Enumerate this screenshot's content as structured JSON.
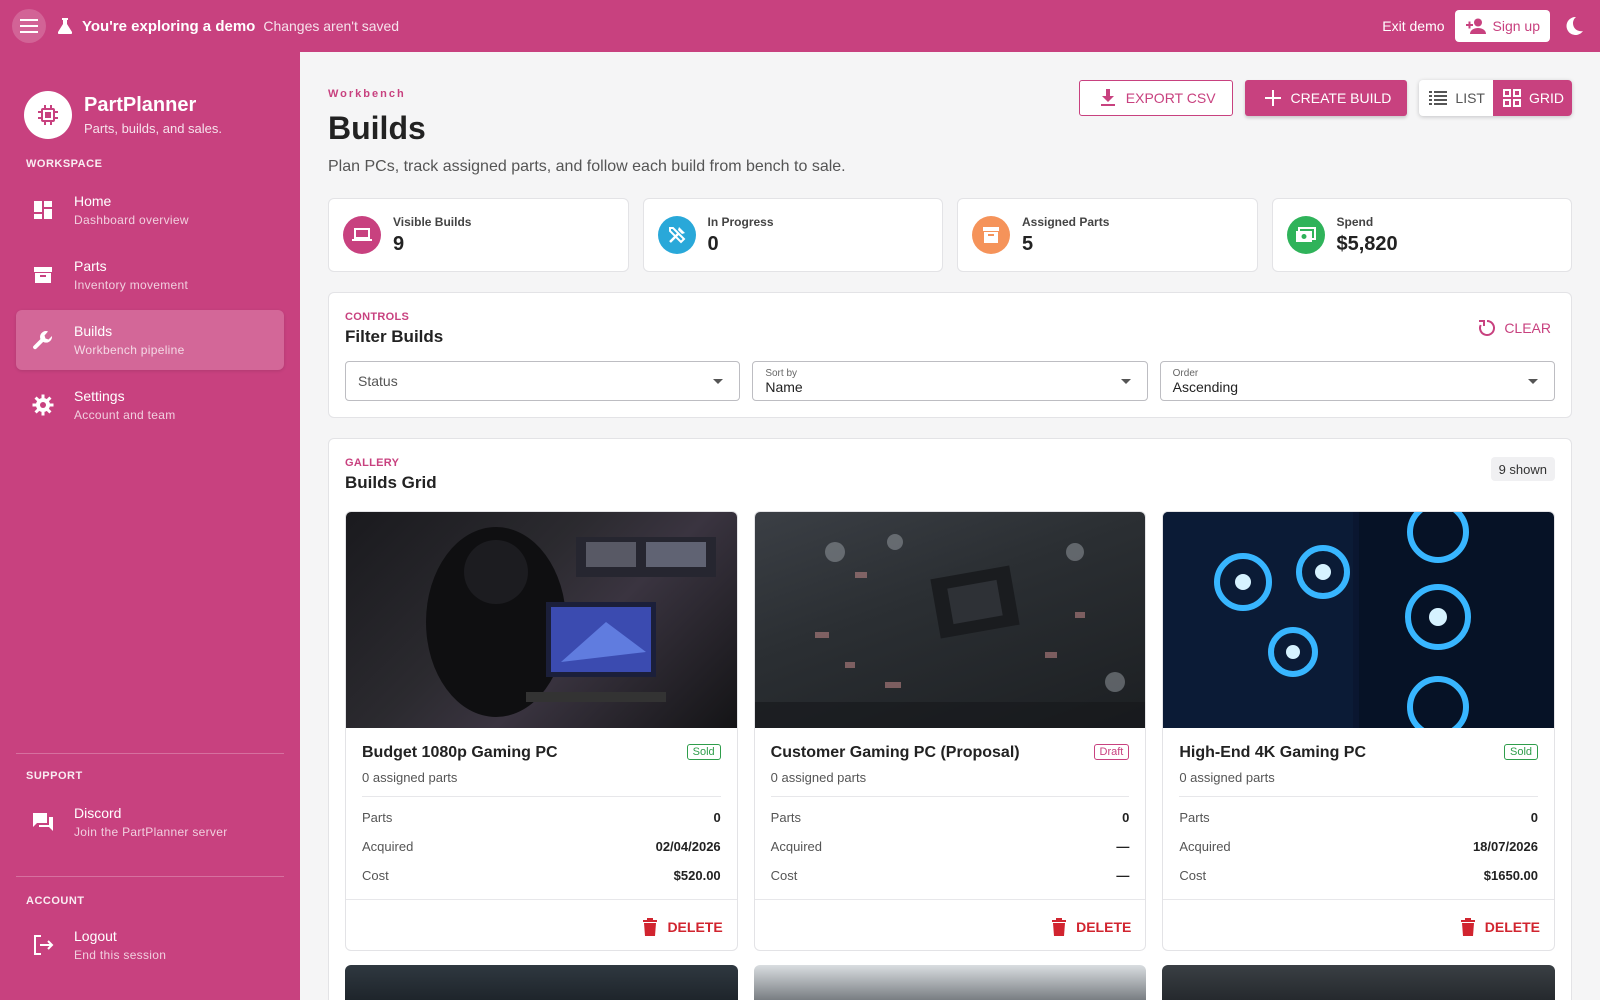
{
  "topbar": {
    "demo_title": "You're exploring a demo",
    "demo_subtitle": "Changes aren't saved",
    "exit_label": "Exit demo",
    "signup_label": "Sign up"
  },
  "brand": {
    "name": "PartPlanner",
    "tagline": "Parts, builds, and sales."
  },
  "sidebar": {
    "sections": {
      "workspace": "WORKSPACE",
      "support": "SUPPORT",
      "account": "ACCOUNT"
    },
    "items": [
      {
        "label": "Home",
        "desc": "Dashboard overview",
        "icon": "dashboard-icon"
      },
      {
        "label": "Parts",
        "desc": "Inventory movement",
        "icon": "archive-icon"
      },
      {
        "label": "Builds",
        "desc": "Workbench pipeline",
        "icon": "wrench-icon",
        "active": true
      },
      {
        "label": "Settings",
        "desc": "Account and team",
        "icon": "gear-icon"
      }
    ],
    "support_items": [
      {
        "label": "Discord",
        "desc": "Join the PartPlanner server",
        "icon": "chat-icon"
      }
    ],
    "account_items": [
      {
        "label": "Logout",
        "desc": "End this session",
        "icon": "logout-icon"
      }
    ]
  },
  "header": {
    "eyebrow": "Workbench",
    "title": "Builds",
    "description": "Plan PCs, track assigned parts, and follow each build from bench to sale.",
    "export_label": "EXPORT CSV",
    "create_label": "CREATE BUILD",
    "view_list_label": "LIST",
    "view_grid_label": "GRID",
    "selected_view": "GRID"
  },
  "stats": [
    {
      "label": "Visible Builds",
      "value": "9",
      "icon": "laptop-icon",
      "color": "#c8417f"
    },
    {
      "label": "In Progress",
      "value": "0",
      "icon": "tools-icon",
      "color": "#29a8d9"
    },
    {
      "label": "Assigned Parts",
      "value": "5",
      "icon": "archive-icon",
      "color": "#f5935a"
    },
    {
      "label": "Spend",
      "value": "$5,820",
      "icon": "cash-icon",
      "color": "#2fb35a"
    }
  ],
  "filters": {
    "eyebrow": "CONTROLS",
    "title": "Filter Builds",
    "clear_label": "CLEAR",
    "status_placeholder": "Status",
    "sort_label": "Sort by",
    "sort_value": "Name",
    "order_label": "Order",
    "order_value": "Ascending"
  },
  "gallery": {
    "eyebrow": "GALLERY",
    "title": "Builds Grid",
    "shown": "9 shown",
    "row_labels": {
      "parts": "Parts",
      "acquired": "Acquired",
      "cost": "Cost"
    },
    "delete_label": "DELETE",
    "cards": [
      {
        "name": "Budget 1080p Gaming PC",
        "status": "Sold",
        "status_color": "#2e9d4a",
        "assigned": "0 assigned parts",
        "parts": "0",
        "acquired": "02/04/2026",
        "cost": "$520.00"
      },
      {
        "name": "Customer Gaming PC (Proposal)",
        "status": "Draft",
        "status_color": "#c8417f",
        "assigned": "0 assigned parts",
        "parts": "0",
        "acquired": "—",
        "cost": "—"
      },
      {
        "name": "High-End 4K Gaming PC",
        "status": "Sold",
        "status_color": "#2e9d4a",
        "assigned": "0 assigned parts",
        "parts": "0",
        "acquired": "18/07/2026",
        "cost": "$1650.00"
      }
    ]
  },
  "colors": {
    "accent": "#c8417f",
    "danger": "#d1242f",
    "success": "#2e9d4a"
  }
}
